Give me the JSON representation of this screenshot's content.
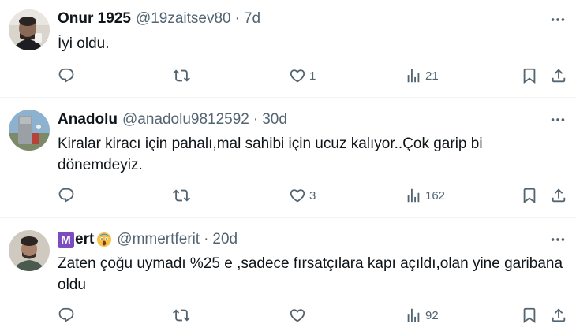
{
  "tweets": [
    {
      "name": "Onur 1925",
      "name_prefix": "",
      "handle": "@19zaitsev80",
      "separator": "·",
      "time": "7d",
      "text": "İyi oldu.",
      "replies": "",
      "retweets": "",
      "likes": "1",
      "views": "21"
    },
    {
      "name": "Anadolu",
      "name_prefix": "",
      "handle": "@anadolu9812592",
      "separator": "·",
      "time": "30d",
      "text": "Kiralar kiracı için pahalı,mal sahibi için ucuz kalıyor..Çok garip bi dönemdeyiz.",
      "replies": "",
      "retweets": "",
      "likes": "3",
      "views": "162"
    },
    {
      "name": "ert",
      "name_prefix": "M",
      "handle": "@mmertferit",
      "separator": "·",
      "time": "20d",
      "text": "Zaten çoğu uymadı %25 e ,sadece fırsatçılara kapı açıldı,olan yine garibana oldu",
      "replies": "",
      "retweets": "",
      "likes": "",
      "views": "92"
    }
  ],
  "icons": {
    "reply": "reply-icon",
    "retweet": "retweet-icon",
    "like": "heart-icon",
    "views": "views-icon",
    "bookmark": "bookmark-icon",
    "share": "share-icon",
    "more": "more-icon"
  },
  "colors": {
    "text": "#0f1419",
    "secondary": "#536471",
    "border": "#eff3f4",
    "zodiac_badge": "#7b4bbf"
  }
}
